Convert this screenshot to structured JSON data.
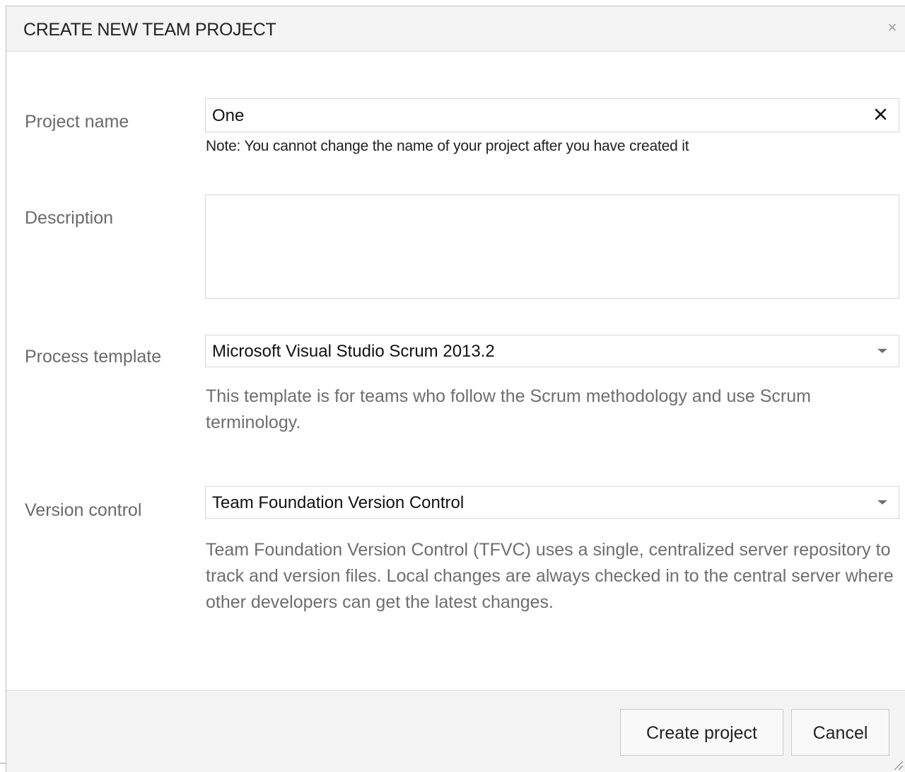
{
  "dialog": {
    "title": "CREATE NEW TEAM PROJECT",
    "close_glyph": "×"
  },
  "project_name": {
    "label": "Project name",
    "value": "One",
    "note": "Note: You cannot change the name of your project after you have created it"
  },
  "description": {
    "label": "Description",
    "value": ""
  },
  "process_template": {
    "label": "Process template",
    "selected": "Microsoft Visual Studio Scrum 2013.2",
    "help": "This template is for teams who follow the Scrum methodology and use Scrum terminology."
  },
  "version_control": {
    "label": "Version control",
    "selected": "Team Foundation Version Control",
    "help": "Team Foundation Version Control (TFVC) uses a single, centralized server repository to track and version files. Local changes are always checked in to the central server where other developers can get the latest changes."
  },
  "footer": {
    "create_label": "Create project",
    "cancel_label": "Cancel"
  },
  "icons": {
    "close": "close-icon",
    "clear": "clear-icon",
    "dropdown": "chevron-down-icon",
    "resize": "resize-grip-icon"
  },
  "colors": {
    "title_bar": "#f4f4f4",
    "label_text": "#6a6a6a",
    "help_text": "#6e6e6e",
    "border": "#d6d6d6"
  }
}
